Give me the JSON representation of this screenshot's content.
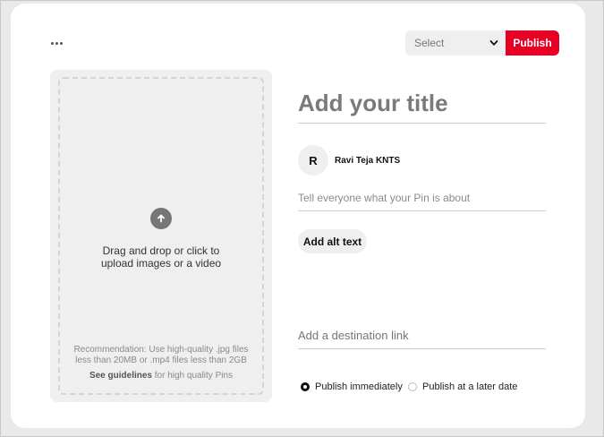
{
  "toolbar": {
    "more_icon": "more-horizontal-icon",
    "select_value": "Select",
    "publish_label": "Publish",
    "publish_color": "#e60023"
  },
  "upload": {
    "icon": "upload-arrow-icon",
    "line1": "Drag and drop or click to",
    "line2": "upload images or a video",
    "reco_line1": "Recommendation: Use high-quality .jpg files",
    "reco_line2": "less than 20MB or .mp4 files less than 2GB",
    "guidelines_link": "See guidelines",
    "guidelines_rest": " for high quality Pins"
  },
  "form": {
    "title_placeholder": "Add your title",
    "avatar_initial": "R",
    "username": "Ravi Teja KNTS",
    "description_placeholder": "Tell everyone what your Pin is about",
    "alt_text_label": "Add alt text",
    "destination_placeholder": "Add a destination link"
  },
  "publish_options": [
    {
      "label": "Publish immediately",
      "selected": true
    },
    {
      "label": "Publish at a later date",
      "selected": false
    }
  ]
}
